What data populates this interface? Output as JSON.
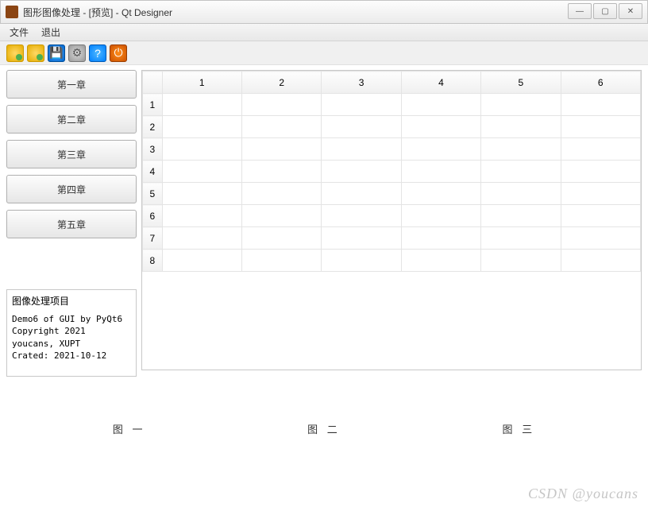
{
  "window": {
    "title": "图形图像处理 - [预览] - Qt Designer"
  },
  "menubar": {
    "items": [
      "文件",
      "退出"
    ]
  },
  "toolbar": {
    "icons": [
      "open-folder",
      "add-folder",
      "save",
      "settings",
      "help",
      "power"
    ]
  },
  "sidebar": {
    "buttons": [
      "第一章",
      "第二章",
      "第三章",
      "第四章",
      "第五章"
    ]
  },
  "info": {
    "title": "图像处理项目",
    "line1": "Demo6 of GUI by PyQt6",
    "line2": "Copyright 2021 youcans, XUPT",
    "line3": "Crated: 2021-10-12"
  },
  "table": {
    "cols": [
      "1",
      "2",
      "3",
      "4",
      "5",
      "6"
    ],
    "rows": [
      "1",
      "2",
      "3",
      "4",
      "5",
      "6",
      "7",
      "8"
    ]
  },
  "bottom": {
    "labels": [
      "图 一",
      "图 二",
      "图 三"
    ]
  },
  "watermark": "CSDN @youcans"
}
